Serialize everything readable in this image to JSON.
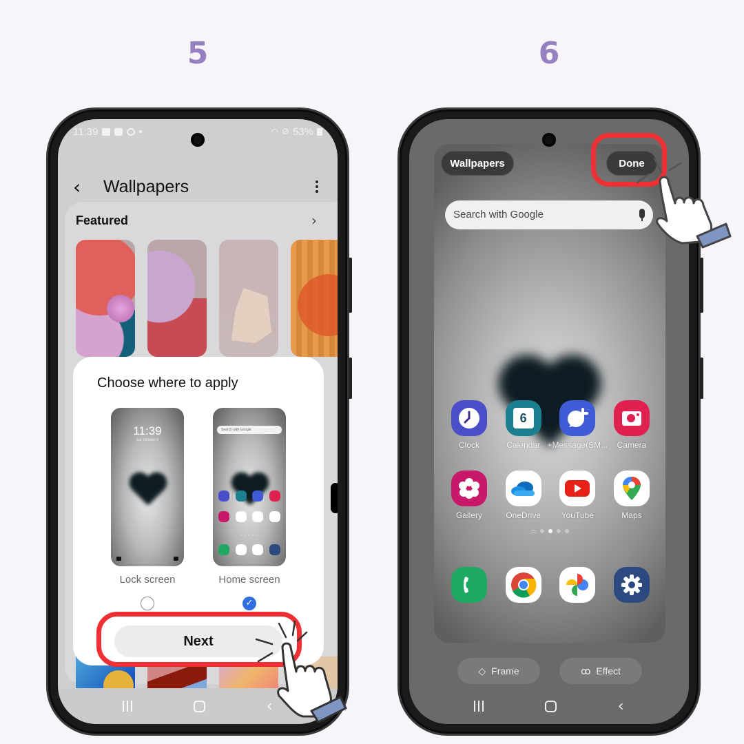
{
  "steps": [
    "5",
    "6"
  ],
  "left_phone": {
    "status_bar": {
      "time": "11:39",
      "battery": "53%"
    },
    "app_bar": {
      "back_icon": "chevron-left",
      "title": "Wallpapers",
      "more_icon": "more-vertical"
    },
    "featured": {
      "label": "Featured",
      "chevron_icon": "chevron-right"
    },
    "dialog": {
      "title": "Choose where to apply",
      "options": [
        {
          "label": "Lock screen",
          "selected": false,
          "preview_time": "11:39",
          "preview_date": "Sat, October 6"
        },
        {
          "label": "Home screen",
          "selected": true,
          "preview_search": "Search with Google"
        }
      ],
      "next_label": "Next"
    },
    "nav": [
      "recents",
      "home",
      "back"
    ]
  },
  "right_phone": {
    "top_left_button": "Wallpapers",
    "done_button": "Done",
    "search_placeholder": "Search with Google",
    "apps_row1": [
      {
        "label": "Clock",
        "color": "#4a4fc9"
      },
      {
        "label": "Calendar",
        "color": "#1b7f8f",
        "glyph": "6"
      },
      {
        "label": "+Message(SM...",
        "color": "#3f5bd6"
      },
      {
        "label": "Camera",
        "color": "#e0204e"
      }
    ],
    "apps_row2": [
      {
        "label": "Gallery",
        "color": "#c8186a"
      },
      {
        "label": "OneDrive",
        "color": "#ffffff"
      },
      {
        "label": "YouTube",
        "color": "#ffffff"
      },
      {
        "label": "Maps",
        "color": "#ffffff"
      }
    ],
    "dock": [
      {
        "name": "Phone",
        "color": "#1fa862"
      },
      {
        "name": "Chrome",
        "color": "#ffffff"
      },
      {
        "name": "Photos",
        "color": "#ffffff"
      },
      {
        "name": "Settings",
        "color": "#2c4a80"
      }
    ],
    "frame_label": "Frame",
    "effect_label": "Effect",
    "nav": [
      "recents",
      "home",
      "back"
    ]
  },
  "highlight_color": "#ee2f33",
  "step_color": "#9680c0"
}
